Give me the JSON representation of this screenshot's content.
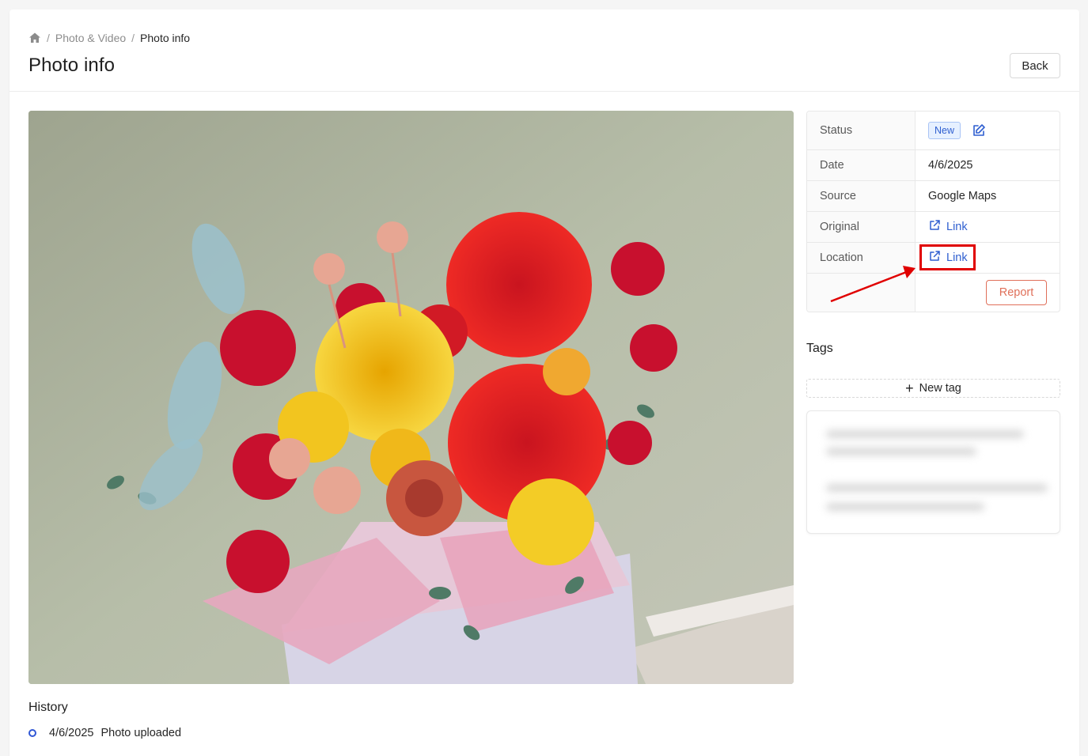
{
  "breadcrumb": {
    "home_icon": "home-icon",
    "separator": "/",
    "items": [
      "Photo & Video",
      "Photo info"
    ]
  },
  "page": {
    "title": "Photo info",
    "back_label": "Back"
  },
  "info": {
    "rows": [
      {
        "label": "Status",
        "value": "New"
      },
      {
        "label": "Date",
        "value": "4/6/2025"
      },
      {
        "label": "Source",
        "value": "Google Maps"
      },
      {
        "label": "Original",
        "value": "Link"
      },
      {
        "label": "Location",
        "value": "Link"
      }
    ],
    "report_label": "Report"
  },
  "tags": {
    "title": "Tags",
    "new_tag_label": "New tag"
  },
  "history": {
    "title": "History",
    "items": [
      {
        "date": "4/6/2025",
        "text": "Photo uploaded"
      }
    ]
  },
  "colors": {
    "accent": "#2f5fd0",
    "danger": "#e0705a",
    "highlight": "#e00000"
  }
}
